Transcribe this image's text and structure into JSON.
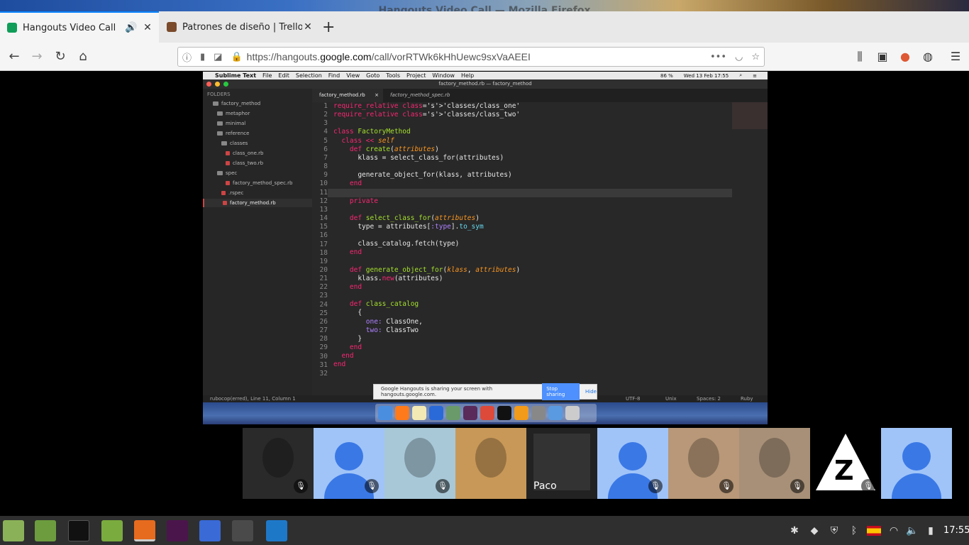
{
  "window": {
    "title": "Hangouts Video Call — Mozilla Firefox"
  },
  "tabs": [
    {
      "title": "Hangouts Video Call",
      "favicon_color": "#0f9d58"
    },
    {
      "title": "Patrones de diseño | Trello",
      "favicon_color": "#7a4a2a"
    }
  ],
  "urlbar": {
    "url_prefix": "https://hangouts.",
    "url_domain": "google.com",
    "url_path": "/call/vorRTWk6kHhUewc9sxVaAEEI"
  },
  "shared_screen": {
    "mac_menu": [
      "Sublime Text",
      "File",
      "Edit",
      "Selection",
      "Find",
      "View",
      "Goto",
      "Tools",
      "Project",
      "Window",
      "Help"
    ],
    "mac_status": {
      "battery": "86 %",
      "datetime": "Wed 13 Feb  17:55"
    },
    "window_title": "factory_method.rb — factory_method",
    "sidebar": {
      "header": "FOLDERS",
      "items": [
        {
          "label": "factory_method",
          "type": "folder"
        },
        {
          "label": "metaphor",
          "type": "folder"
        },
        {
          "label": "minimal",
          "type": "folder"
        },
        {
          "label": "reference",
          "type": "folder"
        },
        {
          "label": "classes",
          "type": "folder"
        },
        {
          "label": "class_one.rb",
          "type": "file"
        },
        {
          "label": "class_two.rb",
          "type": "file"
        },
        {
          "label": "spec",
          "type": "folder"
        },
        {
          "label": "factory_method_spec.rb",
          "type": "file"
        },
        {
          "label": ".rspec",
          "type": "file"
        },
        {
          "label": "factory_method.rb",
          "type": "file"
        }
      ]
    },
    "editor_tabs": [
      "factory_method.rb",
      "factory_method_spec.rb"
    ],
    "status_bar": {
      "left": "rubocop(erred), Line 11, Column 1",
      "encoding": "UTF-8",
      "line_endings": "Unix",
      "indent": "Spaces: 2",
      "syntax": "Ruby"
    },
    "share_notice": {
      "text": "Google Hangouts is sharing your screen with hangouts.google.com.",
      "stop_label": "Stop sharing",
      "hide_label": "Hide"
    }
  },
  "code_lines": [
    "require_relative 'classes/class_one'",
    "require_relative 'classes/class_two'",
    "",
    "class FactoryMethod",
    "  class << self",
    "    def create(attributes)",
    "      klass = select_class_for(attributes)",
    "",
    "      generate_object_for(klass, attributes)",
    "    end",
    "",
    "    private",
    "",
    "    def select_class_for(attributes)",
    "      type = attributes[:type].to_sym",
    "",
    "      class_catalog.fetch(type)",
    "    end",
    "",
    "    def generate_object_for(klass, attributes)",
    "      klass.new(attributes)",
    "    end",
    "",
    "    def class_catalog",
    "      {",
    "        one: ClassOne,",
    "        two: ClassTwo",
    "      }",
    "    end",
    "  end",
    "end",
    ""
  ],
  "participants": [
    {
      "kind": "photo",
      "color": "#2a2a2a",
      "muted": true
    },
    {
      "kind": "avatar",
      "muted": true
    },
    {
      "kind": "photo",
      "color": "#a8c8d8",
      "muted": true
    },
    {
      "kind": "photo",
      "color": "#c89858",
      "muted": false
    },
    {
      "kind": "screen",
      "color": "#222",
      "label": "Paco",
      "muted": false
    },
    {
      "kind": "avatar",
      "muted": true
    },
    {
      "kind": "photo",
      "color": "#b89878",
      "muted": true
    },
    {
      "kind": "photo",
      "color": "#a89078",
      "muted": true
    },
    {
      "kind": "logo",
      "color": "#000",
      "muted": true
    },
    {
      "kind": "avatar",
      "muted": false
    }
  ],
  "taskbar": {
    "time": "17:55"
  }
}
